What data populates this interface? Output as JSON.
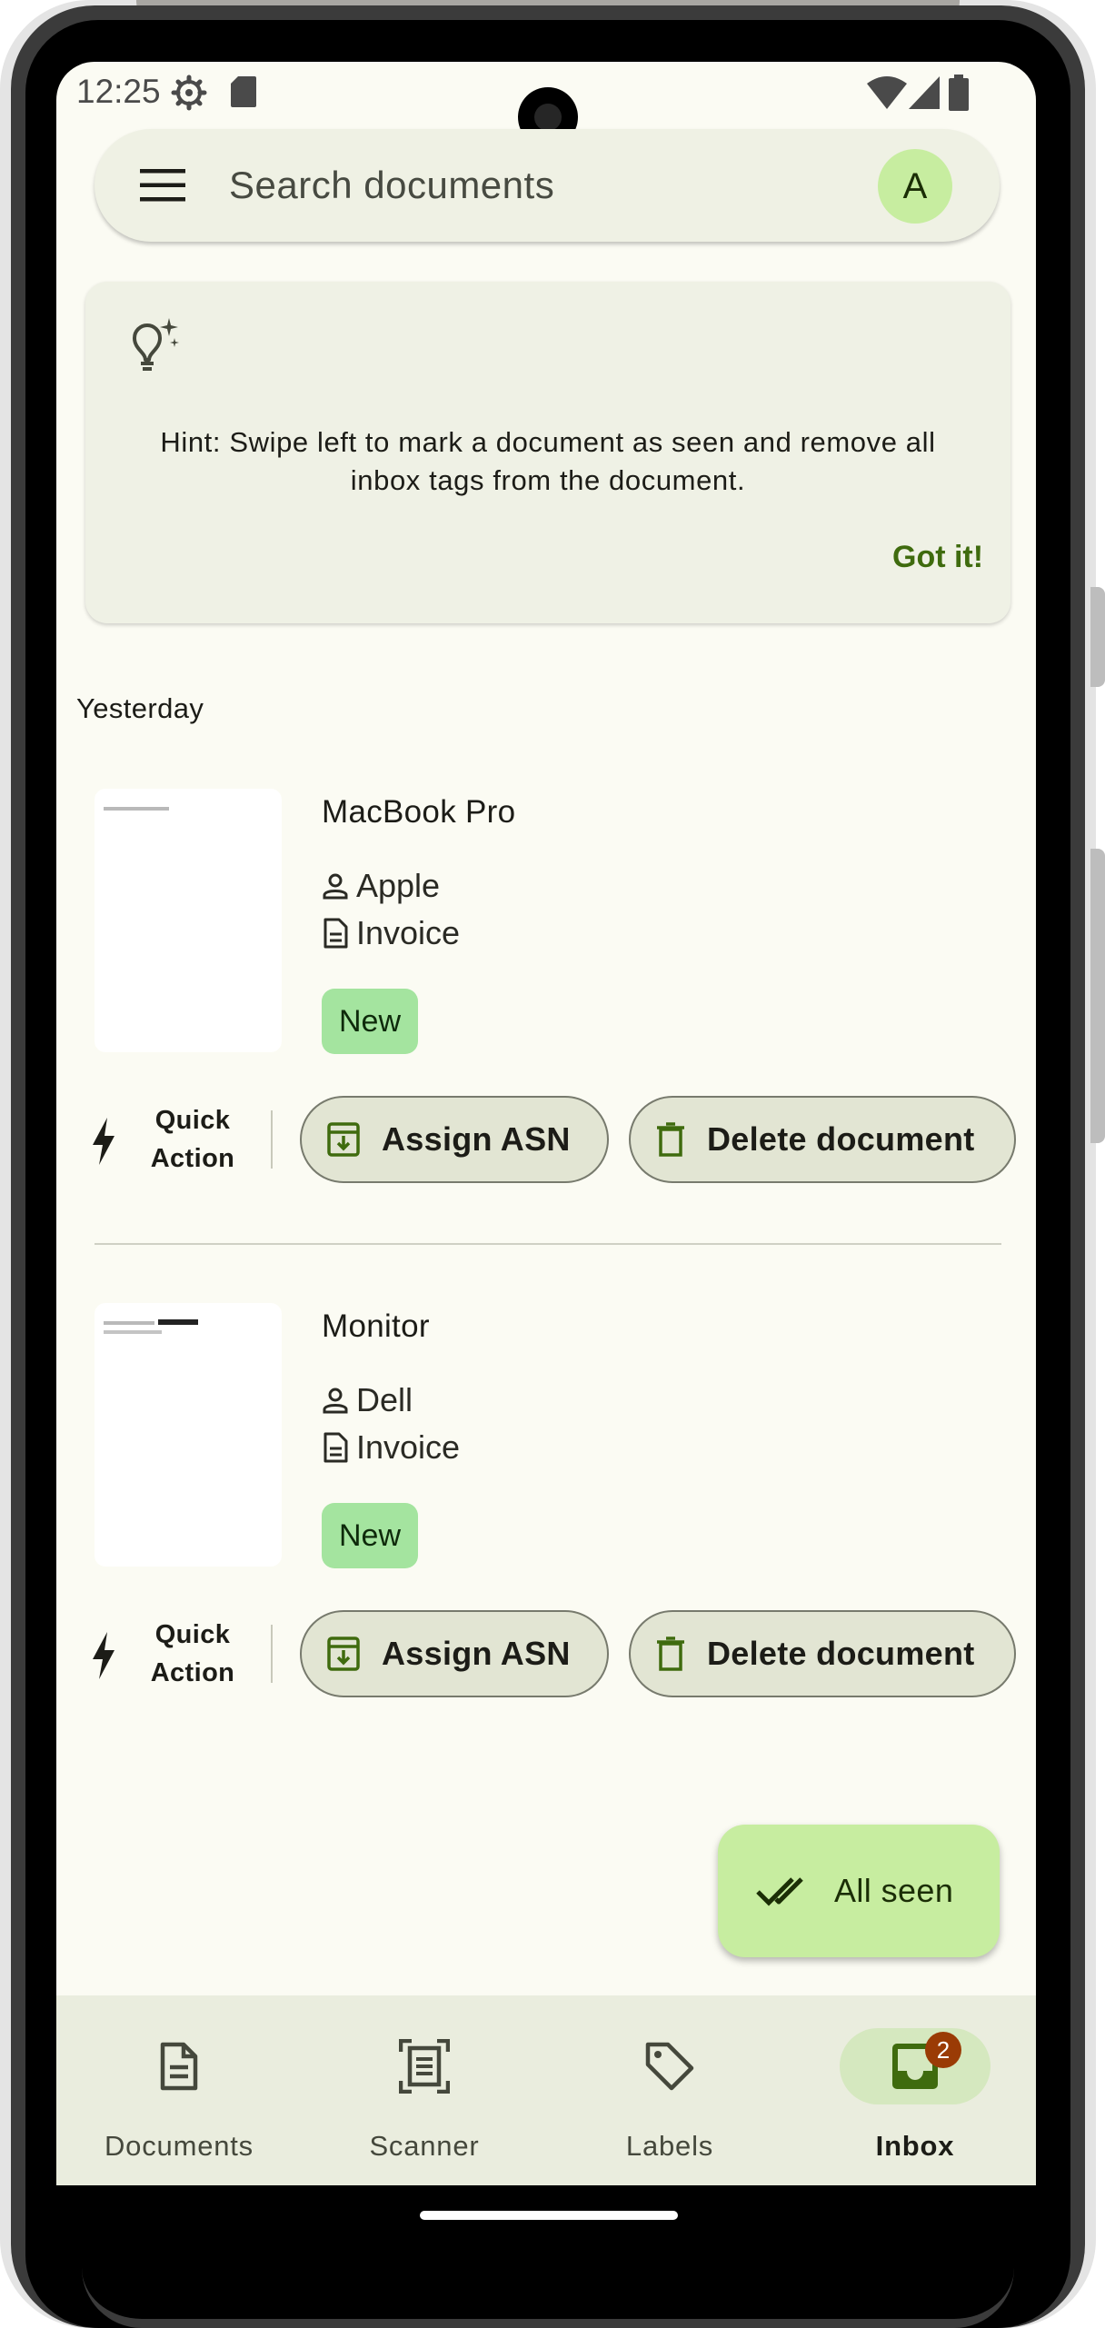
{
  "status_bar": {
    "time": "12:25"
  },
  "search": {
    "placeholder": "Search documents",
    "avatar_letter": "A"
  },
  "hint": {
    "text": "Hint: Swipe left to mark a document as seen and remove all inbox tags from the document.",
    "dismiss_label": "Got it!"
  },
  "section": {
    "label": "Yesterday"
  },
  "documents": [
    {
      "title": "MacBook Pro",
      "correspondent": "Apple",
      "doc_type": "Invoice",
      "tag": "New",
      "quick_action_label_1": "Quick",
      "quick_action_label_2": "Action",
      "assign_asn_label": "Assign ASN",
      "delete_label": "Delete document"
    },
    {
      "title": "Monitor",
      "correspondent": "Dell",
      "doc_type": "Invoice",
      "tag": "New",
      "quick_action_label_1": "Quick",
      "quick_action_label_2": "Action",
      "assign_asn_label": "Assign ASN",
      "delete_label": "Delete document"
    }
  ],
  "fab": {
    "label": "All seen"
  },
  "bottom_nav": {
    "items": [
      {
        "label": "Documents",
        "icon": "document-icon"
      },
      {
        "label": "Scanner",
        "icon": "scanner-icon"
      },
      {
        "label": "Labels",
        "icon": "label-icon"
      },
      {
        "label": "Inbox",
        "icon": "inbox-icon",
        "badge": "2",
        "selected": true
      }
    ]
  },
  "colors": {
    "background": "#fbfbf3",
    "accent_green": "#3f6b0e",
    "tag_green": "#a4e49f",
    "fab_green": "#c7eda0",
    "badge": "#9a3b05"
  }
}
